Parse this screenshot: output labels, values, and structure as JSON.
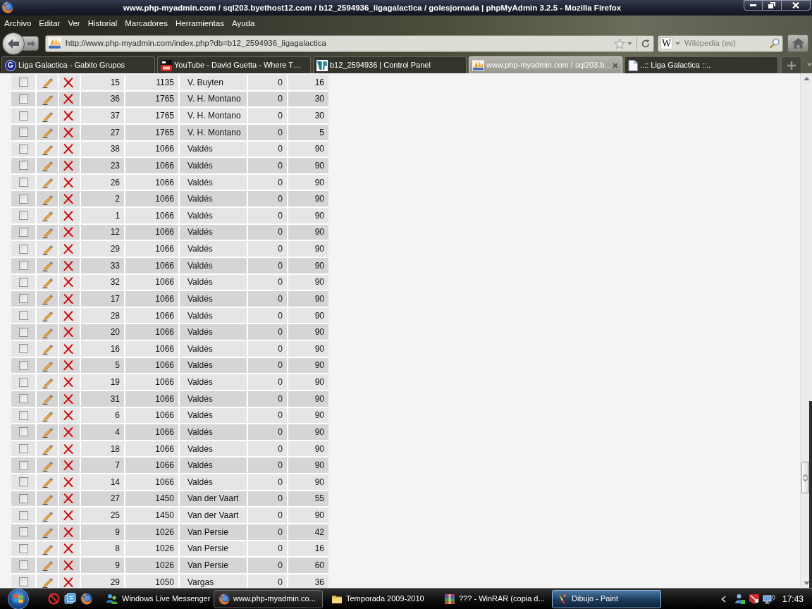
{
  "window": {
    "title": "www.php-myadmin.com / sql203.byethost12.com / b12_2594936_ligagalactica / golesjornada | phpMyAdmin 3.2.5 - Mozilla Firefox"
  },
  "menu": [
    "Archivo",
    "Editar",
    "Ver",
    "Historial",
    "Marcadores",
    "Herramientas",
    "Ayuda"
  ],
  "toolbar": {
    "url": "http://www.php-myadmin.com/index.php?db=b12_2594936_ligagalactica",
    "search": {
      "engine": "W",
      "placeholder": "Wikipedia (es)"
    }
  },
  "tabs": [
    {
      "label": "Liga Galactica - Gabito Grupos",
      "kind": "letter",
      "icon_text": "G",
      "selected": false
    },
    {
      "label": "YouTube - David Guetta - Where T…",
      "kind": "video",
      "selected": false
    },
    {
      "label": "b12_2594936 | Control Panel",
      "kind": "panel",
      "selected": false
    },
    {
      "label": "www.php-myadmin.com / sql203.b…",
      "kind": "pma",
      "selected": true
    },
    {
      "label": "..:: Liga Galactica ::..",
      "kind": "page",
      "selected": false
    }
  ],
  "table": {
    "rows": [
      {
        "checked": false,
        "cells": [
          "15",
          "1135",
          "V. Buyten",
          "0",
          "16"
        ]
      },
      {
        "checked": false,
        "cells": [
          "36",
          "1765",
          "V. H. Montano",
          "0",
          "30"
        ]
      },
      {
        "checked": false,
        "cells": [
          "37",
          "1765",
          "V. H. Montano",
          "0",
          "30"
        ]
      },
      {
        "checked": false,
        "cells": [
          "27",
          "1765",
          "V. H. Montano",
          "0",
          "5"
        ]
      },
      {
        "checked": false,
        "cells": [
          "38",
          "1066",
          "Valdés",
          "0",
          "90"
        ]
      },
      {
        "checked": false,
        "cells": [
          "23",
          "1066",
          "Valdés",
          "0",
          "90"
        ]
      },
      {
        "checked": false,
        "cells": [
          "26",
          "1066",
          "Valdés",
          "0",
          "90"
        ]
      },
      {
        "checked": false,
        "cells": [
          "2",
          "1066",
          "Valdés",
          "0",
          "90"
        ]
      },
      {
        "checked": false,
        "cells": [
          "1",
          "1066",
          "Valdés",
          "0",
          "90"
        ]
      },
      {
        "checked": false,
        "cells": [
          "12",
          "1066",
          "Valdés",
          "0",
          "90"
        ]
      },
      {
        "checked": false,
        "cells": [
          "29",
          "1066",
          "Valdés",
          "0",
          "90"
        ]
      },
      {
        "checked": false,
        "cells": [
          "33",
          "1066",
          "Valdés",
          "0",
          "90"
        ]
      },
      {
        "checked": false,
        "cells": [
          "32",
          "1066",
          "Valdés",
          "0",
          "90"
        ]
      },
      {
        "checked": false,
        "cells": [
          "17",
          "1066",
          "Valdés",
          "0",
          "90"
        ]
      },
      {
        "checked": false,
        "cells": [
          "28",
          "1066",
          "Valdés",
          "0",
          "90"
        ]
      },
      {
        "checked": false,
        "cells": [
          "20",
          "1066",
          "Valdés",
          "0",
          "90"
        ]
      },
      {
        "checked": false,
        "cells": [
          "16",
          "1066",
          "Valdés",
          "0",
          "90"
        ]
      },
      {
        "checked": false,
        "cells": [
          "5",
          "1066",
          "Valdés",
          "0",
          "90"
        ]
      },
      {
        "checked": false,
        "cells": [
          "19",
          "1066",
          "Valdés",
          "0",
          "90"
        ]
      },
      {
        "checked": false,
        "cells": [
          "31",
          "1066",
          "Valdés",
          "0",
          "90"
        ]
      },
      {
        "checked": false,
        "cells": [
          "6",
          "1066",
          "Valdés",
          "0",
          "90"
        ]
      },
      {
        "checked": false,
        "cells": [
          "4",
          "1066",
          "Valdés",
          "0",
          "90"
        ]
      },
      {
        "checked": false,
        "cells": [
          "18",
          "1066",
          "Valdés",
          "0",
          "90"
        ]
      },
      {
        "checked": false,
        "cells": [
          "7",
          "1066",
          "Valdés",
          "0",
          "90"
        ]
      },
      {
        "checked": false,
        "cells": [
          "14",
          "1066",
          "Valdés",
          "0",
          "90"
        ]
      },
      {
        "checked": false,
        "cells": [
          "27",
          "1450",
          "Van der Vaart",
          "0",
          "55"
        ]
      },
      {
        "checked": false,
        "cells": [
          "25",
          "1450",
          "Van der Vaart",
          "0",
          "90"
        ]
      },
      {
        "checked": false,
        "cells": [
          "9",
          "1026",
          "Van Persie",
          "0",
          "42"
        ]
      },
      {
        "checked": false,
        "cells": [
          "8",
          "1026",
          "Van Persie",
          "0",
          "16"
        ]
      },
      {
        "checked": false,
        "cells": [
          "9",
          "1026",
          "Van Persie",
          "0",
          "60"
        ]
      },
      {
        "checked": false,
        "cells": [
          "29",
          "1050",
          "Vargas",
          "0",
          "36"
        ]
      }
    ]
  },
  "taskbar": {
    "items": [
      {
        "label": "Windows Live Messenger",
        "kind": "messenger",
        "selected": false,
        "hovered": false
      },
      {
        "label": "www.php-myadmin.co...",
        "kind": "browser",
        "selected": false,
        "hovered": true
      },
      {
        "label": "Temporada 2009-2010",
        "kind": "folder",
        "selected": false,
        "hovered": false
      },
      {
        "label": "??? - WinRAR (copia d...",
        "kind": "archive",
        "selected": false,
        "hovered": false
      },
      {
        "label": "Dibujo - Paint",
        "kind": "paint",
        "selected": true,
        "hovered": false
      }
    ],
    "clock": "17:43"
  }
}
